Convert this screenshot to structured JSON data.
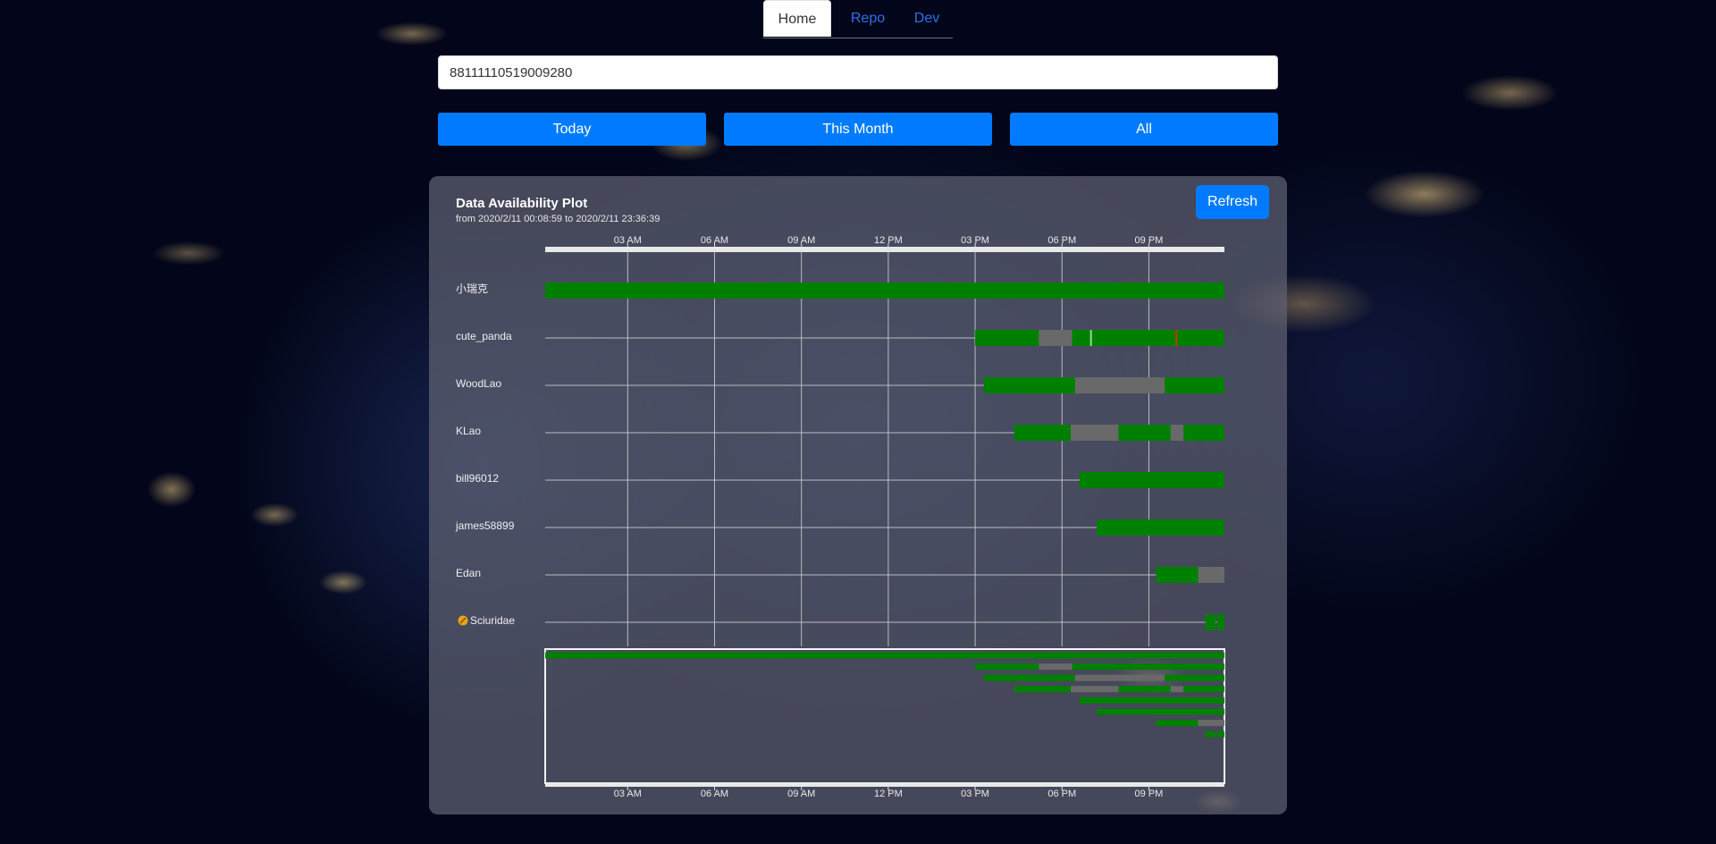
{
  "nav": {
    "tabs": [
      {
        "label": "Home",
        "active": true
      },
      {
        "label": "Repo",
        "active": false
      },
      {
        "label": "Dev",
        "active": false
      }
    ]
  },
  "search": {
    "value": "88111110519009280",
    "placeholder": ""
  },
  "range_buttons": {
    "today": "Today",
    "month": "This Month",
    "all": "All"
  },
  "panel": {
    "title": "Data Availability Plot",
    "subtitle": "from 2020/2/11 00:08:59 to 2020/2/11 23:36:39",
    "refresh_label": "Refresh"
  },
  "colors": {
    "available": "#008000",
    "unavailable": "#696969",
    "marker": "#cc3300",
    "accent": "#007bff",
    "badge": "#e8a317"
  },
  "chart_data": {
    "type": "timeline",
    "x_axis": {
      "range_hours": [
        0.15,
        23.61
      ],
      "ticks": [
        {
          "hour": 3,
          "label": "03 AM"
        },
        {
          "hour": 6,
          "label": "06 AM"
        },
        {
          "hour": 9,
          "label": "09 AM"
        },
        {
          "hour": 12,
          "label": "12 PM"
        },
        {
          "hour": 15,
          "label": "03 PM"
        },
        {
          "hour": 18,
          "label": "06 PM"
        },
        {
          "hour": 21,
          "label": "09 PM"
        }
      ]
    },
    "grid": true,
    "brush_overview": true,
    "rows": [
      {
        "name": "小瑞克",
        "badge": false,
        "segments": [
          {
            "start": 0.15,
            "end": 23.61,
            "state": "available"
          }
        ]
      },
      {
        "name": "cute_panda",
        "badge": false,
        "segments": [
          {
            "start": 15.0,
            "end": 17.2,
            "state": "available"
          },
          {
            "start": 17.2,
            "end": 18.35,
            "state": "unavailable"
          },
          {
            "start": 18.35,
            "end": 23.61,
            "state": "available"
          }
        ],
        "markers": [
          19.0,
          21.95
        ]
      },
      {
        "name": "WoodLao",
        "badge": false,
        "segments": [
          {
            "start": 15.3,
            "end": 18.45,
            "state": "available"
          },
          {
            "start": 18.45,
            "end": 21.55,
            "state": "unavailable"
          },
          {
            "start": 21.55,
            "end": 23.61,
            "state": "available"
          }
        ]
      },
      {
        "name": "KLao",
        "badge": false,
        "segments": [
          {
            "start": 16.35,
            "end": 18.3,
            "state": "available"
          },
          {
            "start": 18.3,
            "end": 19.95,
            "state": "unavailable"
          },
          {
            "start": 19.95,
            "end": 21.75,
            "state": "available"
          },
          {
            "start": 21.75,
            "end": 22.2,
            "state": "unavailable"
          },
          {
            "start": 22.2,
            "end": 23.61,
            "state": "available"
          }
        ]
      },
      {
        "name": "bill96012",
        "badge": false,
        "segments": [
          {
            "start": 18.6,
            "end": 23.61,
            "state": "available"
          }
        ]
      },
      {
        "name": "james58899",
        "badge": false,
        "segments": [
          {
            "start": 19.2,
            "end": 23.61,
            "state": "available"
          }
        ]
      },
      {
        "name": "Edan",
        "badge": false,
        "segments": [
          {
            "start": 21.25,
            "end": 22.7,
            "state": "available"
          },
          {
            "start": 22.7,
            "end": 23.61,
            "state": "unavailable"
          }
        ]
      },
      {
        "name": "Sciuridae",
        "badge": true,
        "segments": [
          {
            "start": 22.95,
            "end": 23.3,
            "state": "available"
          },
          {
            "start": 23.35,
            "end": 23.61,
            "state": "available"
          }
        ]
      }
    ]
  }
}
